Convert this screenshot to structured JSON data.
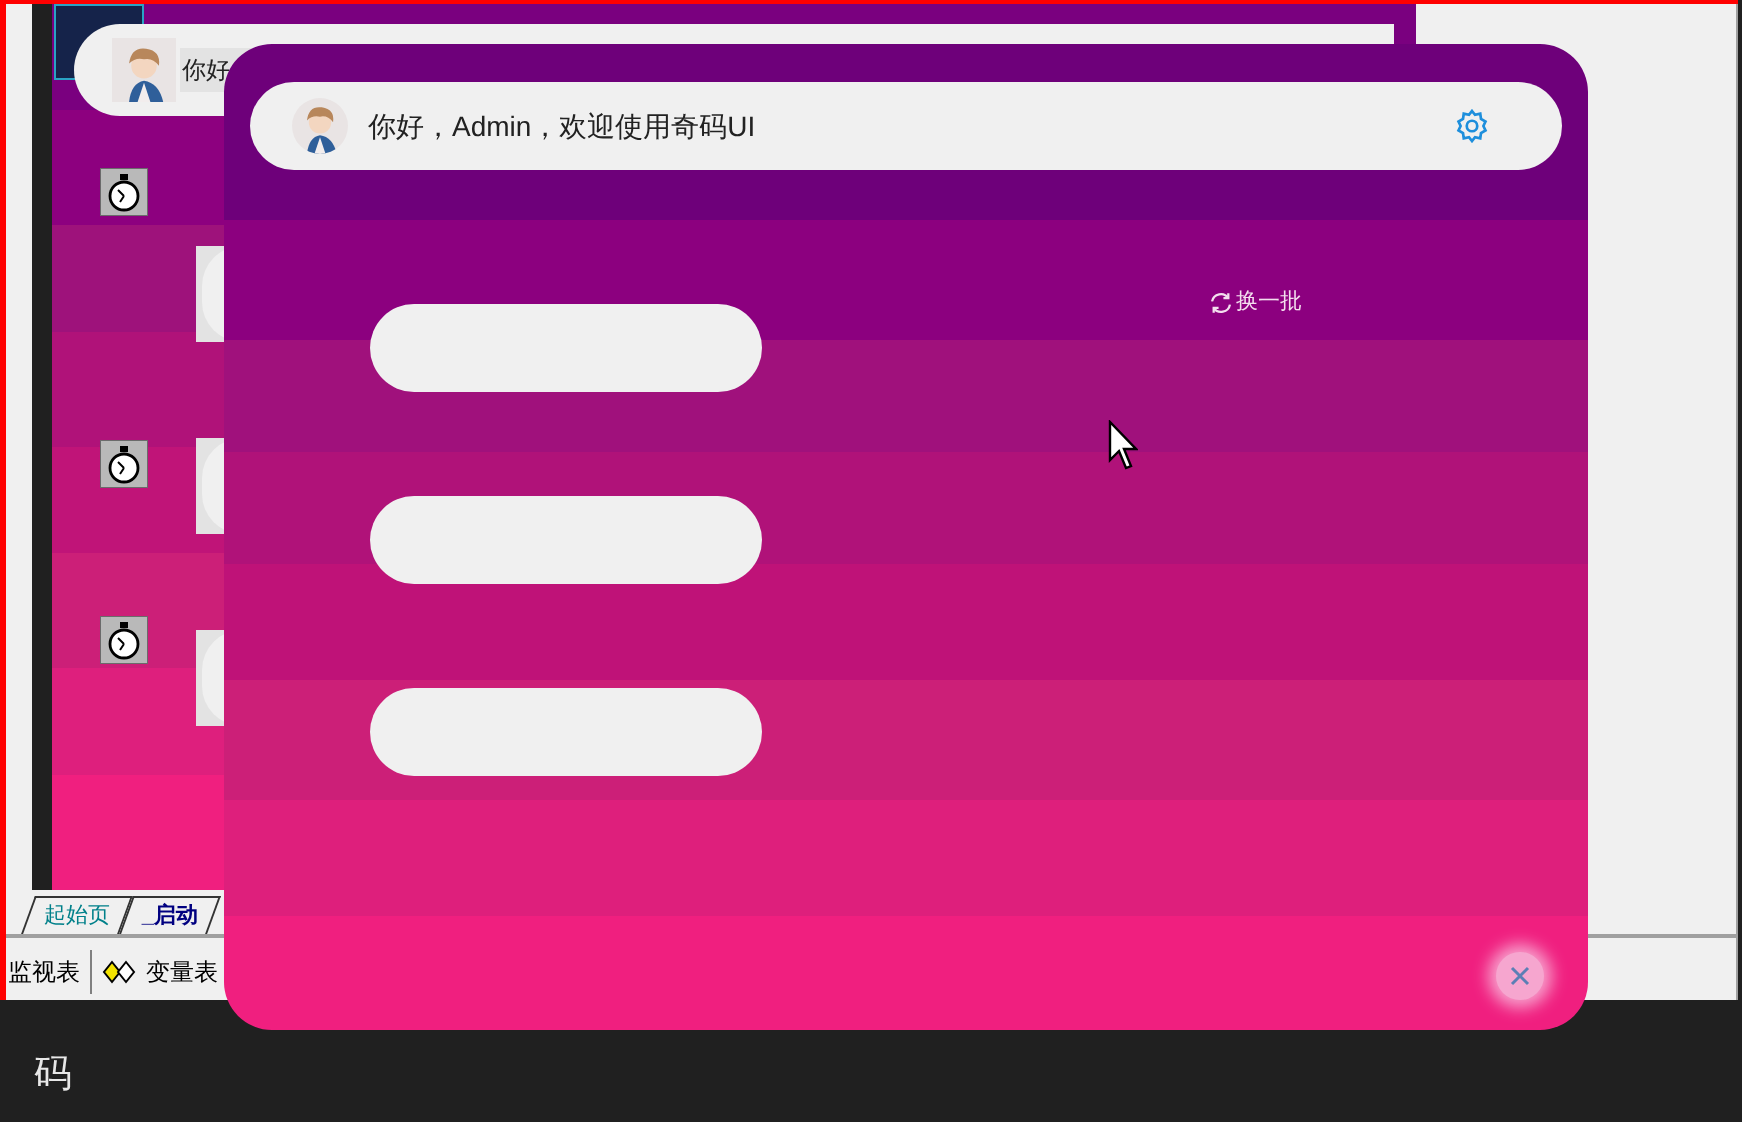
{
  "background_window": {
    "ghost_greeting": "你好",
    "tabs": [
      {
        "label": "起始页",
        "selected": false
      },
      {
        "label": "_启动",
        "selected": true
      }
    ],
    "panels": [
      "监视表",
      "变量表"
    ],
    "editor_label": "码"
  },
  "popup": {
    "greeting": "你好，Admin，欢迎使用奇码UI",
    "refresh_label": "换一批",
    "slots": [
      {
        "kind": "blank"
      },
      {
        "kind": "blank"
      },
      {
        "kind": "blank"
      }
    ]
  }
}
